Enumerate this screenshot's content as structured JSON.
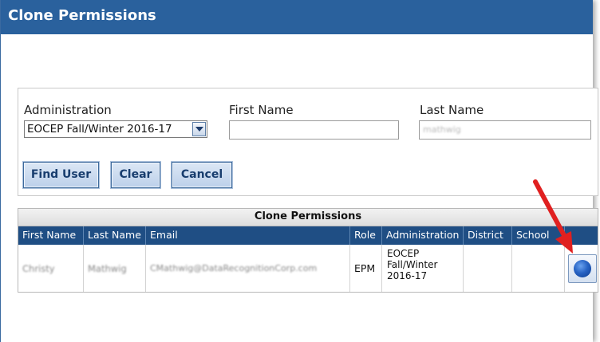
{
  "window": {
    "title": "Clone Permissions"
  },
  "form": {
    "administration_label": "Administration",
    "administration_value": "EOCEP Fall/Winter 2016-17",
    "first_name_label": "First Name",
    "first_name_value": "",
    "last_name_label": "Last Name",
    "last_name_value": "mathwig"
  },
  "buttons": {
    "find_user": "Find User",
    "clear": "Clear",
    "cancel": "Cancel"
  },
  "results": {
    "caption": "Clone Permissions",
    "columns": [
      "First Name",
      "Last Name",
      "Email",
      "Role",
      "Administration",
      "District",
      "School",
      ""
    ],
    "rows": [
      {
        "first_name": "Christy",
        "last_name": "Mathwig",
        "email": "CMathwig@DataRecognitionCorp.com",
        "role": "EPM",
        "administration_line1": "EOCEP",
        "administration_line2": "Fall/Winter",
        "administration_line3": "2016-17",
        "district": "",
        "school": ""
      }
    ]
  },
  "colors": {
    "titlebar": "#2a619d",
    "table_header": "#1f4e84",
    "button_text": "#183d6e",
    "annotation_arrow": "#e02020"
  },
  "icons": {
    "select_action": "blue-circle-select-icon",
    "annotation": "red-arrow-icon",
    "dropdown": "chevron-down-icon"
  }
}
